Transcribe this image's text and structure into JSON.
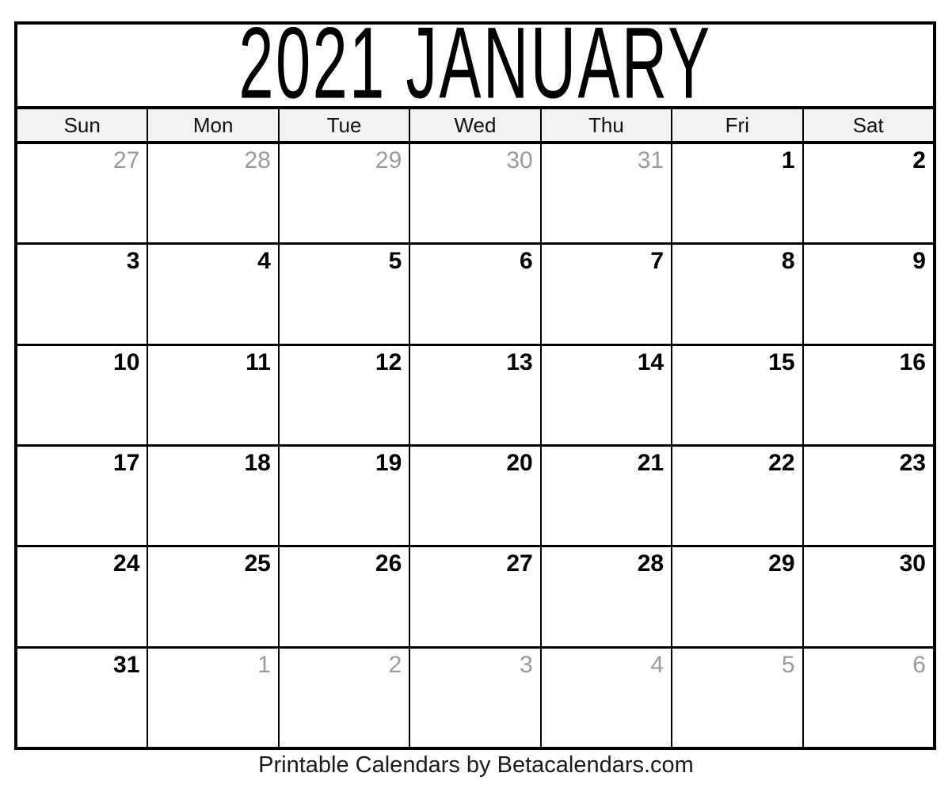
{
  "calendar": {
    "title": "2021 JANUARY",
    "year": "2021",
    "month": "JANUARY",
    "weekday_headers": [
      {
        "label": "Sun"
      },
      {
        "label": "Mon"
      },
      {
        "label": "Tue"
      },
      {
        "label": "Wed"
      },
      {
        "label": "Thu"
      },
      {
        "label": "Fri"
      },
      {
        "label": "Sat"
      }
    ],
    "weeks": [
      {
        "days": [
          {
            "number": "27",
            "in_month": false
          },
          {
            "number": "28",
            "in_month": false
          },
          {
            "number": "29",
            "in_month": false
          },
          {
            "number": "30",
            "in_month": false
          },
          {
            "number": "31",
            "in_month": false
          },
          {
            "number": "1",
            "in_month": true
          },
          {
            "number": "2",
            "in_month": true
          }
        ]
      },
      {
        "days": [
          {
            "number": "3",
            "in_month": true
          },
          {
            "number": "4",
            "in_month": true
          },
          {
            "number": "5",
            "in_month": true
          },
          {
            "number": "6",
            "in_month": true
          },
          {
            "number": "7",
            "in_month": true
          },
          {
            "number": "8",
            "in_month": true
          },
          {
            "number": "9",
            "in_month": true
          }
        ]
      },
      {
        "days": [
          {
            "number": "10",
            "in_month": true
          },
          {
            "number": "11",
            "in_month": true
          },
          {
            "number": "12",
            "in_month": true
          },
          {
            "number": "13",
            "in_month": true
          },
          {
            "number": "14",
            "in_month": true
          },
          {
            "number": "15",
            "in_month": true
          },
          {
            "number": "16",
            "in_month": true
          }
        ]
      },
      {
        "days": [
          {
            "number": "17",
            "in_month": true
          },
          {
            "number": "18",
            "in_month": true
          },
          {
            "number": "19",
            "in_month": true
          },
          {
            "number": "20",
            "in_month": true
          },
          {
            "number": "21",
            "in_month": true
          },
          {
            "number": "22",
            "in_month": true
          },
          {
            "number": "23",
            "in_month": true
          }
        ]
      },
      {
        "days": [
          {
            "number": "24",
            "in_month": true
          },
          {
            "number": "25",
            "in_month": true
          },
          {
            "number": "26",
            "in_month": true
          },
          {
            "number": "27",
            "in_month": true
          },
          {
            "number": "28",
            "in_month": true
          },
          {
            "number": "29",
            "in_month": true
          },
          {
            "number": "30",
            "in_month": true
          }
        ]
      },
      {
        "days": [
          {
            "number": "31",
            "in_month": true
          },
          {
            "number": "1",
            "in_month": false
          },
          {
            "number": "2",
            "in_month": false
          },
          {
            "number": "3",
            "in_month": false
          },
          {
            "number": "4",
            "in_month": false
          },
          {
            "number": "5",
            "in_month": false
          },
          {
            "number": "6",
            "in_month": false
          }
        ]
      }
    ]
  },
  "footer": {
    "text": "Printable Calendars by Betacalendars.com"
  },
  "colors": {
    "border": "#000000",
    "header_background": "#f2f2f2",
    "in_month_text": "#000000",
    "adjacent_month_text": "#9b9b9b",
    "page_background": "#ffffff"
  }
}
